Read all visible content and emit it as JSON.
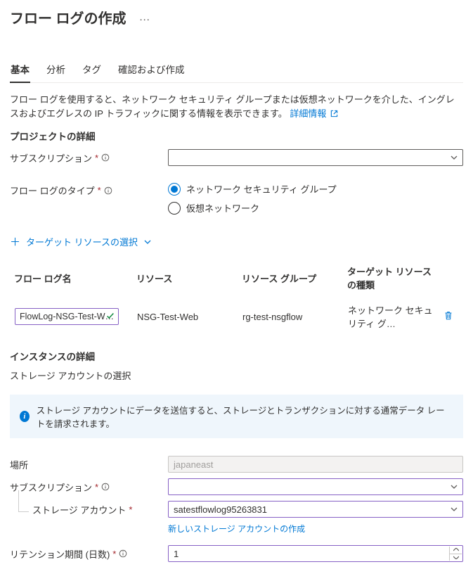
{
  "header": {
    "title": "フロー ログの作成",
    "more": "…"
  },
  "tabs": [
    "基本",
    "分析",
    "タグ",
    "確認および作成"
  ],
  "selectedTab": 0,
  "description": "フロー ログを使用すると、ネットワーク セキュリティ グループまたは仮想ネットワークを介した、イングレスおよびエグレスの IP トラフィックに関する情報を表示できます。",
  "learnMore": "詳細情報",
  "projectDetailsTitle": "プロジェクトの詳細",
  "labels": {
    "subscription": "サブスクリプション",
    "flowLogType": "フロー ログのタイプ",
    "location": "場所",
    "storageAccount": "ストレージ アカウント",
    "retention": "リテンション期間 (日数)"
  },
  "radios": {
    "nsg": "ネットワーク セキュリティ グループ",
    "vnet": "仮想ネットワーク"
  },
  "selectTarget": "ターゲット リソースの選択",
  "tableHeaders": {
    "flowLogName": "フロー ログ名",
    "resource": "リソース",
    "resourceGroup": "リソース グループ",
    "targetType": "ターゲット リソースの種類"
  },
  "row": {
    "flowLogName": "FlowLog-NSG-Test-W…",
    "resource": "NSG-Test-Web",
    "resourceGroup": "rg-test-nsgflow",
    "targetType": "ネットワーク セキュリティ グ…"
  },
  "instanceDetailsTitle": "インスタンスの詳細",
  "storageSelectText": "ストレージ アカウントの選択",
  "infoBanner": "ストレージ アカウントにデータを送信すると、ストレージとトランザクションに対する通常データ レートを請求されます。",
  "locationField": "japaneast",
  "subscription2Value": "",
  "storageAccountValue": "satestflowlog95263831",
  "createNewStorage": "新しいストレージ アカウントの作成",
  "retentionValue": "1"
}
